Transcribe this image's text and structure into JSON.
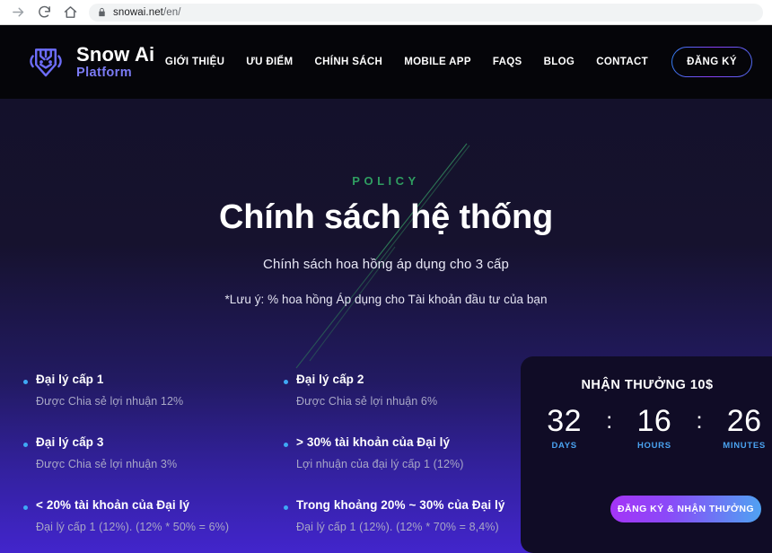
{
  "browser": {
    "url_host": "snowai.net",
    "url_path": "/en/",
    "forward_icon": "arrow-right-icon",
    "reload_icon": "reload-icon",
    "home_icon": "home-icon",
    "lock_icon": "lock-icon"
  },
  "header": {
    "logo": {
      "icon": "snow-ai-shield-logo-icon",
      "title": "Snow Ai",
      "subtitle": "Platform",
      "accent_color": "#7b7bf5"
    },
    "nav": [
      {
        "label": "GIỚI THIỆU"
      },
      {
        "label": "ƯU ĐIỂM"
      },
      {
        "label": "CHÍNH SÁCH"
      },
      {
        "label": "MOBILE APP"
      },
      {
        "label": "FAQS"
      },
      {
        "label": "BLOG"
      },
      {
        "label": "CONTACT"
      }
    ],
    "signup_label": "ĐĂNG KÝ"
  },
  "hero": {
    "eyebrow": "POLICY",
    "eyebrow_color": "#2f9e61",
    "title": "Chính sách hệ thống",
    "subtitle_1": "Chính sách hoa hồng áp dụng cho 3 cấp",
    "subtitle_2": "*Lưu ý: % hoa hồng Áp dụng cho Tài khoản đầu tư của bạn"
  },
  "policy_items": [
    {
      "title": "Đại lý cấp 1",
      "desc": "Được Chia sẻ lợi nhuận 12%"
    },
    {
      "title": "Đại lý cấp 2",
      "desc": "Được Chia sẻ lợi nhuận 6%"
    },
    {
      "title": "Đại lý cấp 3",
      "desc": "Được Chia sẻ lợi nhuận 3%"
    },
    {
      "title": "> 30% tài khoản của Đại lý",
      "desc": "Lợi nhuận của đại lý cấp 1 (12%)"
    },
    {
      "title": "< 20% tài khoản của Đại lý",
      "desc": "Đại lý cấp 1 (12%). (12% * 50% = 6%)"
    },
    {
      "title": "Trong khoảng 20% ~ 30% của Đại lý",
      "desc": "Đại lý cấp 1 (12%). (12% * 70% = 8,4%)"
    }
  ],
  "countdown": {
    "heading": "NHẬN THƯỞNG 10$",
    "units": [
      {
        "value": "32",
        "label": "DAYS"
      },
      {
        "value": "16",
        "label": "HOURS"
      },
      {
        "value": "26",
        "label": "MINUTES"
      }
    ],
    "separator": ":",
    "cta_label": "ĐĂNG KÝ & NHẬN THƯỞNG",
    "label_color": "#4aa3f0"
  }
}
